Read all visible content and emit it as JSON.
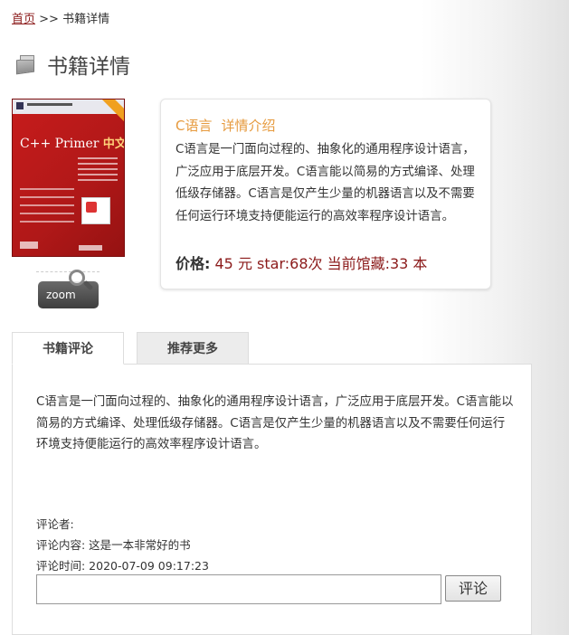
{
  "breadcrumb": {
    "home": "首页",
    "separator": ">>",
    "current": "书籍详情"
  },
  "page_title": "书籍详情",
  "title_icon": "books-icon",
  "book": {
    "cover_title": "C++ Primer",
    "cover_title_cn": "中文版",
    "zoom_label": "zoom",
    "info_heading_name": "C语言",
    "info_heading_suffix": "详情介绍",
    "description": "C语言是一门面向过程的、抽象化的通用程序设计语言，广泛应用于底层开发。C语言能以简易的方式编译、处理低级存储器。C语言是仅产生少量的机器语言以及不需要任何运行环境支持便能运行的高效率程序设计语言。",
    "price_label": "价格:",
    "price_value": "45 元 star:68次  当前馆藏:33 本"
  },
  "tabs": [
    {
      "label": "书籍评论",
      "active": true
    },
    {
      "label": "推荐更多",
      "active": false
    }
  ],
  "review": {
    "text": "C语言是一门面向过程的、抽象化的通用程序设计语言，广泛应用于底层开发。C语言能以简易的方式编译、处理低级存储器。C语言是仅产生少量的机器语言以及不需要任何运行环境支持便能运行的高效率程序设计语言。",
    "commenter": "评论者:",
    "content": "评论内容: 这是一本非常好的书",
    "time": "评论时间: 2020-07-09 09:17:23",
    "input_value": "",
    "submit_label": "评论"
  },
  "colors": {
    "link": "#8b1a1a",
    "heading_accent": "#e69a3e",
    "price": "#8b1a1a"
  }
}
